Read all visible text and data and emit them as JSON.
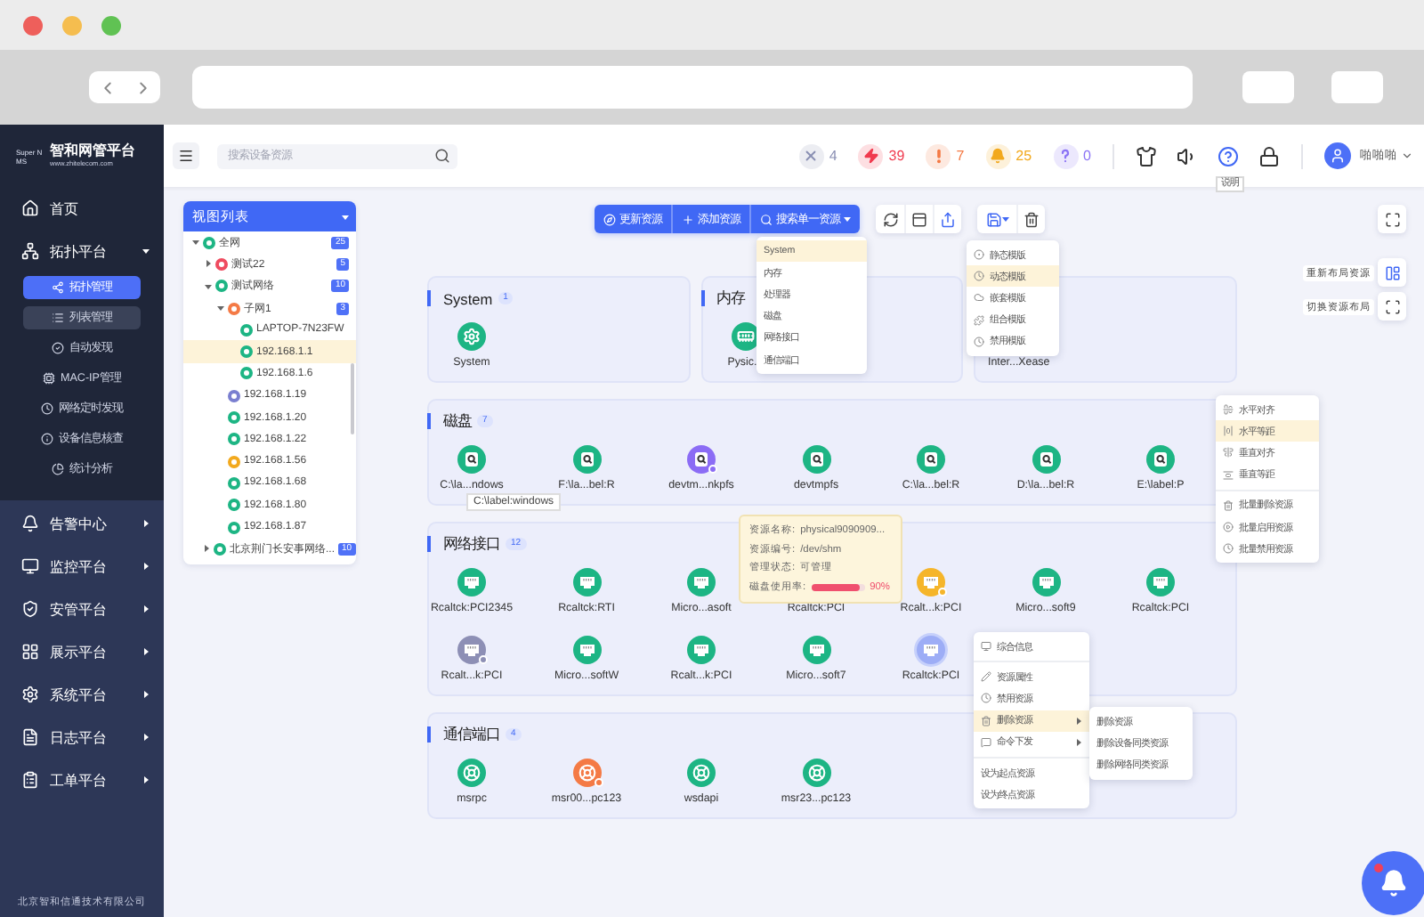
{
  "sidebar": {
    "brand": {
      "mark": "Super NMS",
      "title": "智和网管平台",
      "subtitle": "www.zhitelecom.com"
    },
    "menu": [
      {
        "label": "首页"
      },
      {
        "label": "拓扑平台",
        "expanded": true,
        "children": [
          {
            "label": "拓扑管理",
            "selected": true,
            "highlighted": false
          },
          {
            "label": "列表管理",
            "selected": false,
            "highlighted": true
          },
          {
            "label": "自动发现",
            "selected": false,
            "highlighted": false
          },
          {
            "label": "MAC-IP管理",
            "selected": false,
            "highlighted": false
          },
          {
            "label": "网络定时发现",
            "selected": false,
            "highlighted": false
          },
          {
            "label": "设备信息核查",
            "selected": false,
            "highlighted": false
          },
          {
            "label": "统计分析",
            "selected": false,
            "highlighted": false
          }
        ]
      },
      {
        "label": "告警中心",
        "expanded": false
      },
      {
        "label": "监控平台",
        "expanded": false
      },
      {
        "label": "安管平台",
        "expanded": false
      },
      {
        "label": "展示平台",
        "expanded": false
      },
      {
        "label": "系统平台",
        "expanded": false
      },
      {
        "label": "日志平台",
        "expanded": false
      },
      {
        "label": "工单平台",
        "expanded": false
      }
    ],
    "footer": "北京智和信通技术有限公司"
  },
  "header": {
    "search": {
      "placeholder": "搜索设备资源"
    },
    "alerts": [
      {
        "kind": "closed",
        "count": "4",
        "color": "#8a8fb3"
      },
      {
        "kind": "critical",
        "count": "39",
        "color": "#f03a4e"
      },
      {
        "kind": "warning",
        "count": "7",
        "color": "#f47a45"
      },
      {
        "kind": "notice",
        "count": "25",
        "color": "#f2a91d"
      },
      {
        "kind": "unknown",
        "count": "0",
        "color": "#8b73f5"
      }
    ],
    "tools": [
      {
        "kind": "theme"
      },
      {
        "kind": "sound"
      },
      {
        "kind": "help",
        "tooltip": "说明"
      },
      {
        "kind": "lock"
      }
    ],
    "user": {
      "name": "啪啪啪"
    }
  },
  "view_list": {
    "title": "视图列表",
    "tree": [
      {
        "label": "全网",
        "count": "25",
        "color": "#1db584",
        "expanded": true,
        "selected": false,
        "children": [
          {
            "label": "测试22",
            "count": "5",
            "color": "#ef4b5f",
            "expanded": false,
            "selected": false
          },
          {
            "label": "测试网络",
            "count": "10",
            "color": "#1db584",
            "expanded": true,
            "selected": false,
            "children": [
              {
                "label": "子网1",
                "count": "3",
                "color": "#f47a45",
                "expanded": true,
                "selected": false,
                "children": [
                  {
                    "label": "LAPTOP-7N23FW",
                    "color": "#1db584",
                    "selected": false
                  },
                  {
                    "label": "192.168.1.1",
                    "color": "#1db584",
                    "selected": true
                  },
                  {
                    "label": "192.168.1.6",
                    "color": "#1db584",
                    "selected": false
                  }
                ]
              },
              {
                "label": "192.168.1.19",
                "color": "#7a7fd0",
                "selected": false
              },
              {
                "label": "192.168.1.20",
                "color": "#1db584",
                "selected": false
              },
              {
                "label": "192.168.1.22",
                "color": "#1db584",
                "selected": false
              },
              {
                "label": "192.168.1.56",
                "color": "#f2a91d",
                "selected": false
              },
              {
                "label": "192.168.1.68",
                "color": "#1db584",
                "selected": false
              },
              {
                "label": "192.168.1.80",
                "color": "#1db584",
                "selected": false
              },
              {
                "label": "192.168.1.87",
                "color": "#1db584",
                "selected": false
              }
            ]
          },
          {
            "label": "北京荆门长安事网络...",
            "count": "10",
            "color": "#1db584",
            "expanded": false,
            "selected": false
          }
        ]
      }
    ]
  },
  "actions": [
    {
      "label": "更新资源",
      "dropdown": false
    },
    {
      "label": "添加资源",
      "dropdown": false
    },
    {
      "label": "搜索单一资源",
      "dropdown": true
    }
  ],
  "icon_tools": [
    {
      "kind": "refresh"
    },
    {
      "kind": "window"
    },
    {
      "kind": "export"
    }
  ],
  "template_tools": [
    {
      "kind": "template",
      "dropdown": true
    },
    {
      "kind": "delete",
      "dropdown": false
    }
  ],
  "layout_tools": [
    {
      "label": "重新布局资源",
      "kind": "relayout"
    },
    {
      "label": "切换资源布局",
      "kind": "switch"
    }
  ],
  "group_rows": [
    [
      {
        "title": "System",
        "count": "1",
        "nodes": [
          {
            "label": "System",
            "kind": "system",
            "color": "#1db584",
            "selected": false
          }
        ]
      },
      {
        "title": "内存",
        "nodes": [
          {
            "label": "Pysic...",
            "kind": "memory",
            "color": "#1db584",
            "selected": false
          }
        ]
      },
      {
        "nodes": [
          {
            "label": "Inter...Xease"
          }
        ]
      }
    ],
    [
      {
        "title": "磁盘",
        "count": "7",
        "nodes": [
          {
            "label": "C:\\la...ndows",
            "kind": "disk",
            "color": "#1db584",
            "selected": false
          },
          {
            "label": "F:\\la...bel:R",
            "kind": "disk",
            "color": "#1db584",
            "selected": false
          },
          {
            "label": "devtm...nkpfs",
            "kind": "disk",
            "color": "#8b6cf5",
            "badge": {
              "color": "#8b6cf5"
            },
            "selected": false
          },
          {
            "label": "devtmpfs",
            "kind": "disk",
            "color": "#1db584",
            "selected": false
          },
          {
            "label": "C:\\la...bel:R",
            "kind": "disk",
            "color": "#1db584",
            "selected": false
          },
          {
            "label": "D:\\la...bel:R",
            "kind": "disk",
            "color": "#1db584",
            "selected": false
          },
          {
            "label": "E:\\label:P",
            "kind": "disk",
            "color": "#1db584",
            "selected": false
          }
        ]
      }
    ],
    [
      {
        "title": "网络接口",
        "count": "12",
        "nodes": [
          {
            "label": "Rcaltck:PCI2345",
            "kind": "network",
            "color": "#1db584",
            "selected": false
          },
          {
            "label": "Rcaltck:RTI",
            "kind": "network",
            "color": "#1db584",
            "selected": false
          },
          {
            "label": "Micro...asoft",
            "kind": "network",
            "color": "#1db584",
            "selected": false
          },
          {
            "label": "Rcaltck:PCI"
          },
          {
            "label": "Rcalt...k:PCI",
            "kind": "network",
            "color": "#f5b52a",
            "badge": {
              "color": "#f5b52a"
            },
            "selected": false
          },
          {
            "label": "Micro...soft9",
            "kind": "network",
            "color": "#1db584",
            "selected": false
          },
          {
            "label": "Rcaltck:PCI",
            "kind": "network",
            "color": "#1db584",
            "selected": false
          },
          {
            "label": "Rcalt...k:PCI",
            "kind": "network",
            "color": "#8d8fb5",
            "badge": {
              "color": "#8d8fb5"
            },
            "selected": false
          },
          {
            "label": "Micro...softW",
            "kind": "network",
            "color": "#1db584",
            "selected": false
          },
          {
            "label": "Rcalt...k:PCI",
            "kind": "network",
            "color": "#1db584",
            "selected": false
          },
          {
            "label": "Micro...soft7",
            "kind": "network",
            "color": "#1db584",
            "selected": false
          },
          {
            "label": "Rcaltck:PCI",
            "kind": "network",
            "color": "#9dadf6",
            "selected": true
          }
        ]
      }
    ],
    [
      {
        "title": "通信端口",
        "count": "4",
        "nodes": [
          {
            "label": "msrpc",
            "kind": "comm",
            "color": "#1db584",
            "selected": false
          },
          {
            "label": "msr00...pc123",
            "kind": "comm",
            "color": "#f47a45",
            "badge": {
              "color": "#f47a45"
            },
            "selected": false
          },
          {
            "label": "wsdapi",
            "kind": "comm",
            "color": "#1db584",
            "selected": false
          },
          {
            "label": "msr23...pc123",
            "kind": "comm",
            "color": "#1db584",
            "selected": false
          }
        ]
      }
    ]
  ],
  "search_menu": {
    "items": [
      {
        "label": "System",
        "selected": true
      },
      {
        "label": "内存",
        "selected": false
      },
      {
        "label": "处理器",
        "selected": false
      },
      {
        "label": "磁盘",
        "selected": false
      },
      {
        "label": "网络接口",
        "selected": false
      },
      {
        "label": "通信端口",
        "selected": false
      }
    ]
  },
  "template_menu": {
    "items": [
      {
        "label": "静态模版",
        "selected": false
      },
      {
        "label": "动态模版",
        "selected": true
      },
      {
        "label": "嵌套模版",
        "selected": false
      },
      {
        "label": "组合模版",
        "selected": false
      },
      {
        "label": "禁用模版",
        "selected": false
      }
    ]
  },
  "node_tooltip": {
    "text": "C:\\label:windows"
  },
  "info_card": {
    "rows": [
      {
        "kind": "text",
        "label": "资源名称:",
        "value": "physical9090909..."
      },
      {
        "kind": "text",
        "label": "资源编号:",
        "value": "/dev/shm"
      },
      {
        "kind": "text",
        "label": "管理状态:",
        "value": "可管理"
      },
      {
        "kind": "meter",
        "label": "磁盘使用率:",
        "level": 0.9,
        "value": "90%"
      }
    ]
  },
  "align_menu": {
    "sections": [
      [
        {
          "label": "水平对齐",
          "selected": false
        },
        {
          "label": "水平等距",
          "selected": true
        },
        {
          "label": "垂直对齐",
          "selected": false
        },
        {
          "label": "垂直等距",
          "selected": false
        }
      ],
      [
        {
          "label": "批量删除资源",
          "selected": false
        },
        {
          "label": "批量启用资源",
          "selected": false
        },
        {
          "label": "批量禁用资源",
          "selected": false
        }
      ]
    ]
  },
  "context_menu": {
    "sections": [
      [
        {
          "label": "综合信息",
          "selected": false,
          "submenu": false
        }
      ],
      [
        {
          "label": "资源属性",
          "selected": false,
          "submenu": false
        },
        {
          "label": "禁用资源",
          "selected": false,
          "submenu": false
        },
        {
          "label": "删除资源",
          "selected": true,
          "submenu": true
        },
        {
          "label": "命令下发",
          "selected": false,
          "submenu": true
        }
      ],
      [
        {
          "label": "设为起点资源",
          "selected": false,
          "submenu": false
        },
        {
          "label": "设为终点资源",
          "selected": false,
          "submenu": false
        }
      ]
    ]
  },
  "delete_submenu": {
    "items": [
      {
        "label": "删除资源",
        "selected": false
      },
      {
        "label": "删除设备同类资源",
        "selected": false
      },
      {
        "label": "删除网络同类资源",
        "selected": false
      }
    ]
  },
  "notification_button": {
    "unread": true
  }
}
